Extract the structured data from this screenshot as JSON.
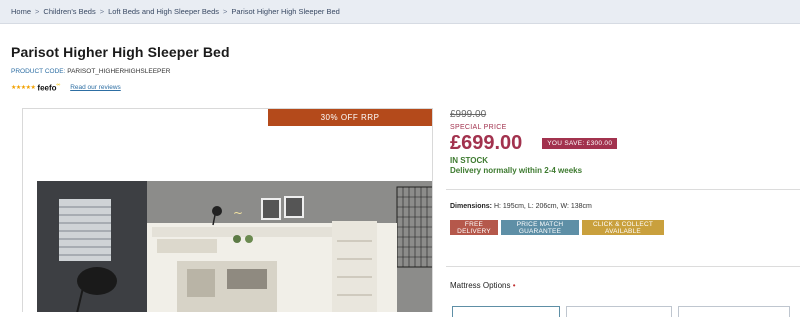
{
  "breadcrumb": {
    "items": [
      "Home",
      "Children's Beds",
      "Loft Beds and High Sleeper Beds",
      "Parisot Higher High Sleeper Bed"
    ],
    "separator": ">"
  },
  "product": {
    "title": "Parisot Higher High Sleeper Bed",
    "code_label": "PRODUCT CODE:",
    "code_value": "PARISOT_HIGHERHIGHSLEEPER",
    "stars": "★★★★★",
    "feefo": "feefo",
    "feefo_sup": "ºº",
    "read_reviews": "Read our reviews"
  },
  "image": {
    "badge": "30% OFF RRP"
  },
  "pricing": {
    "rrp": "£999.00",
    "special_label": "SPECIAL PRICE",
    "price": "£699.00",
    "you_save": "YOU SAVE: £300.00",
    "stock": "IN STOCK",
    "delivery": "Delivery normally within 2-4 weeks"
  },
  "dimensions": {
    "label": "Dimensions:",
    "value": "H: 195cm, L: 206cm, W: 138cm"
  },
  "badges": [
    {
      "line1": "FREE",
      "line2": "DELIVERY"
    },
    {
      "line1": "PRICE MATCH",
      "line2": "GUARANTEE"
    },
    {
      "line1": "CLICK & COLLECT",
      "line2": "AVAILABLE"
    }
  ],
  "options": {
    "mattress_label": "Mattress Options",
    "required_mark": "•"
  },
  "colors": {
    "accent": "#a2324e",
    "stock_green": "#3d7a2f",
    "badge_orange": "#b44a1b"
  }
}
